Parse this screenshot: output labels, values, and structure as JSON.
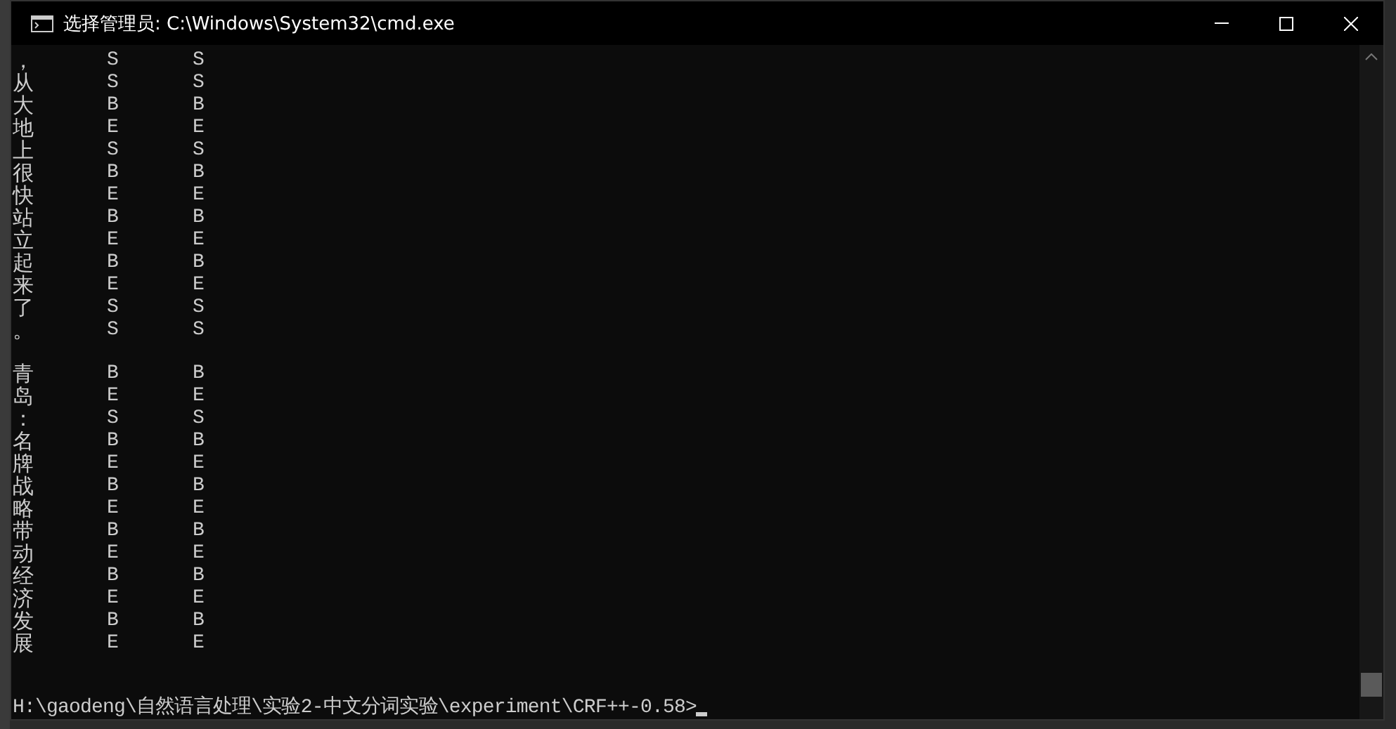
{
  "window": {
    "title": "选择管理员: C:\\Windows\\System32\\cmd.exe"
  },
  "output_blocks": [
    {
      "rows": [
        {
          "column_1": "，",
          "column_2": "S",
          "column_3": "S"
        },
        {
          "column_1": "从",
          "column_2": "S",
          "column_3": "S"
        },
        {
          "column_1": "大",
          "column_2": "B",
          "column_3": "B"
        },
        {
          "column_1": "地",
          "column_2": "E",
          "column_3": "E"
        },
        {
          "column_1": "上",
          "column_2": "S",
          "column_3": "S"
        },
        {
          "column_1": "很",
          "column_2": "B",
          "column_3": "B"
        },
        {
          "column_1": "快",
          "column_2": "E",
          "column_3": "E"
        },
        {
          "column_1": "站",
          "column_2": "B",
          "column_3": "B"
        },
        {
          "column_1": "立",
          "column_2": "E",
          "column_3": "E"
        },
        {
          "column_1": "起",
          "column_2": "B",
          "column_3": "B"
        },
        {
          "column_1": "来",
          "column_2": "E",
          "column_3": "E"
        },
        {
          "column_1": "了",
          "column_2": "S",
          "column_3": "S"
        },
        {
          "column_1": "。",
          "column_2": "S",
          "column_3": "S"
        }
      ]
    },
    {
      "rows": [
        {
          "column_1": "青",
          "column_2": "B",
          "column_3": "B"
        },
        {
          "column_1": "岛",
          "column_2": "E",
          "column_3": "E"
        },
        {
          "column_1": "：",
          "column_2": "S",
          "column_3": "S"
        },
        {
          "column_1": "名",
          "column_2": "B",
          "column_3": "B"
        },
        {
          "column_1": "牌",
          "column_2": "E",
          "column_3": "E"
        },
        {
          "column_1": "战",
          "column_2": "B",
          "column_3": "B"
        },
        {
          "column_1": "略",
          "column_2": "E",
          "column_3": "E"
        },
        {
          "column_1": "带",
          "column_2": "B",
          "column_3": "B"
        },
        {
          "column_1": "动",
          "column_2": "E",
          "column_3": "E"
        },
        {
          "column_1": "经",
          "column_2": "B",
          "column_3": "B"
        },
        {
          "column_1": "济",
          "column_2": "E",
          "column_3": "E"
        },
        {
          "column_1": "发",
          "column_2": "B",
          "column_3": "B"
        },
        {
          "column_1": "展",
          "column_2": "E",
          "column_3": "E"
        }
      ]
    }
  ],
  "prompt": {
    "text": "H:\\gaodeng\\自然语言处理\\实验2-中文分词实验\\experiment\\CRF++-0.58>",
    "cursor": true
  }
}
